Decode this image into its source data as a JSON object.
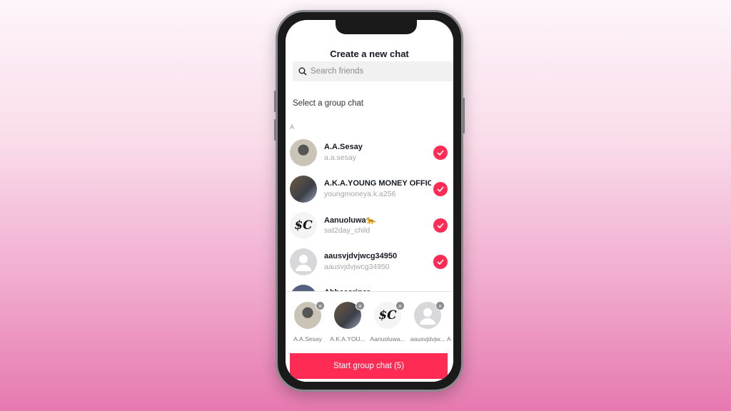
{
  "header": {
    "title": "Create a new chat"
  },
  "search": {
    "placeholder": "Search friends"
  },
  "section_label": "Select a group chat",
  "index_letter": "A",
  "contacts": [
    {
      "name": "A.A.Sesay",
      "username": "a.a.sesay",
      "selected": true
    },
    {
      "name": "A.K.A.YOUNG MONEY OFFICIAL",
      "username": "youngmoneya.k.a256",
      "selected": true
    },
    {
      "name": "Aanuoluwa🐆",
      "username": "sat2day_child",
      "selected": true
    },
    {
      "name": "aausvjdvjwcg34950",
      "username": "aausvjdvjwcg34950",
      "selected": true
    },
    {
      "name": "Abbeesriper",
      "username": "",
      "selected": true
    }
  ],
  "selected_tray": [
    {
      "label": "A.A.Sesay"
    },
    {
      "label": "A.K.A.YOU..."
    },
    {
      "label": "Aanuoluwa..."
    },
    {
      "label": "aausvjdvjw..."
    },
    {
      "label": "A"
    }
  ],
  "avatar_text": "$C",
  "start_button": "Start group chat (5)",
  "colors": {
    "accent": "#fe2c55"
  }
}
